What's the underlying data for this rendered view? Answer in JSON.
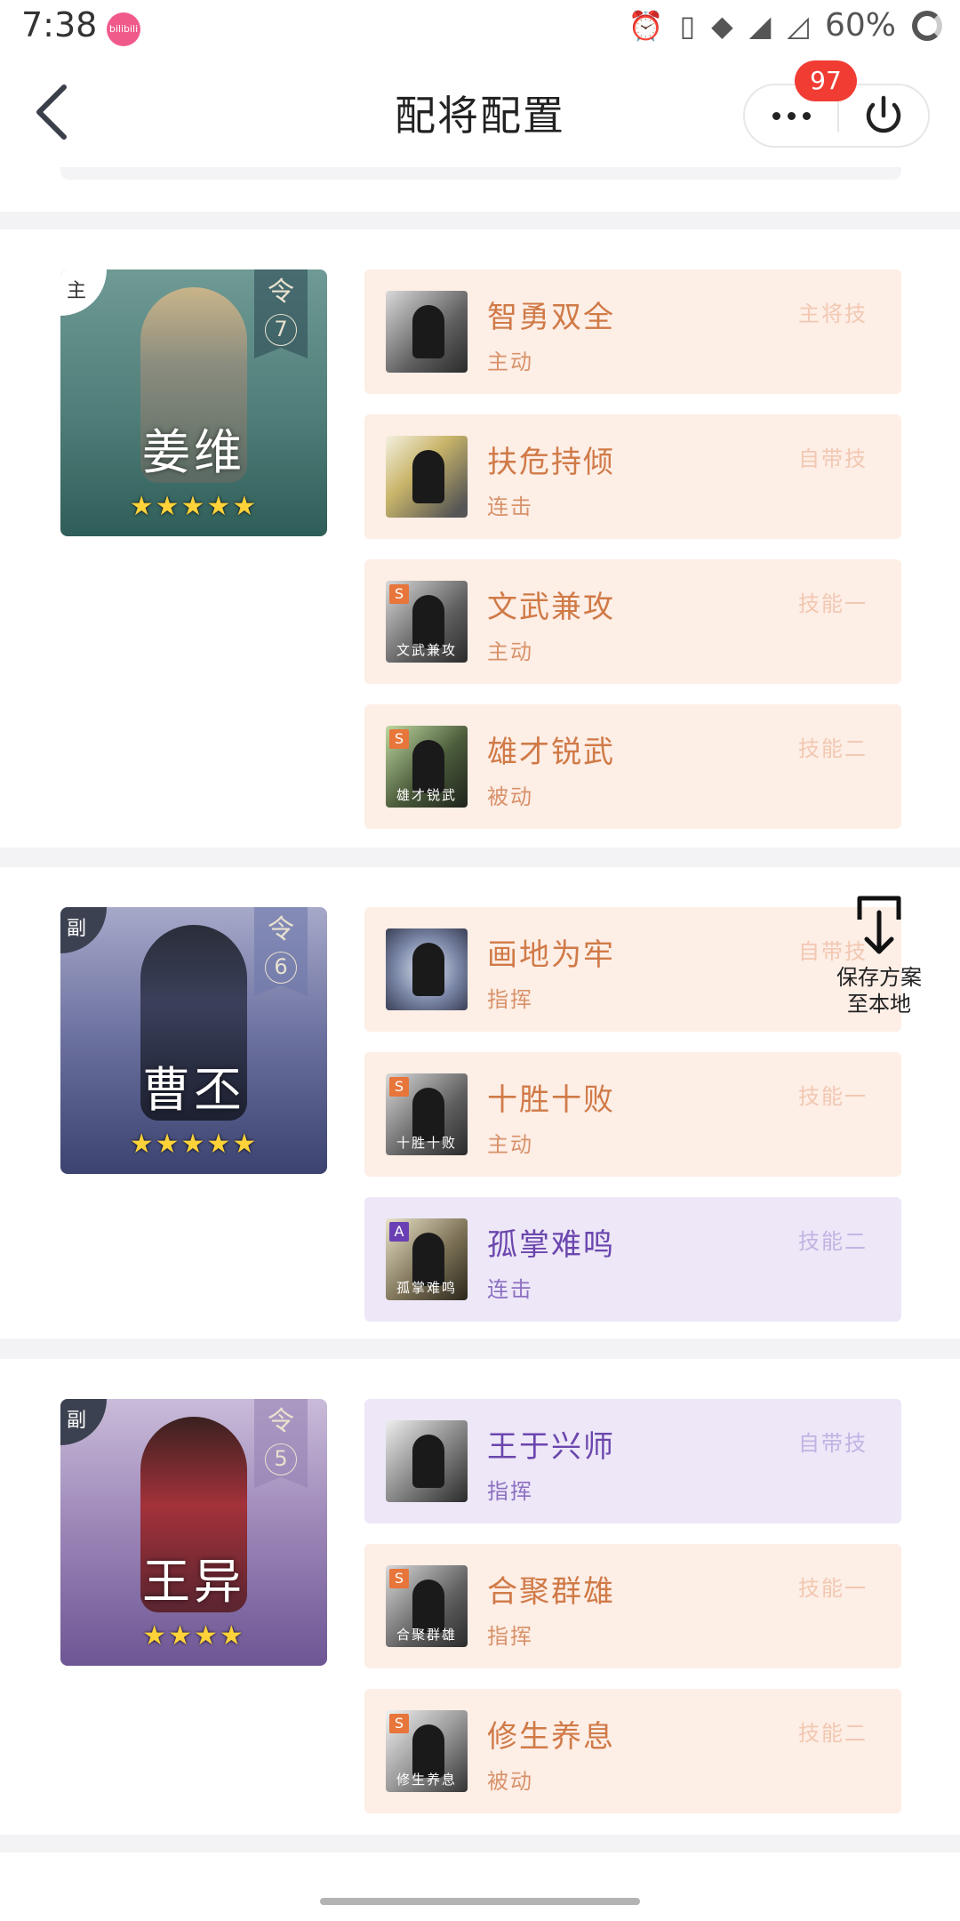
{
  "status_bar": {
    "time": "7:38",
    "app_badge": "bilibili",
    "battery": "60%"
  },
  "nav": {
    "title": "配将配置",
    "badge_count": "97"
  },
  "float_save": {
    "label_line1": "保存方案",
    "label_line2": "至本地"
  },
  "heroes": [
    {
      "tag": "主",
      "name": "姜维",
      "ling": "令",
      "level": "7",
      "stars": "★★★★★",
      "skills": [
        {
          "name": "智勇双全",
          "type": "主动",
          "slot": "主将技",
          "grade": "",
          "caption": "",
          "theme": "orange"
        },
        {
          "name": "扶危持倾",
          "type": "连击",
          "slot": "自带技",
          "grade": "",
          "caption": "",
          "theme": "orange"
        },
        {
          "name": "文武兼攻",
          "type": "主动",
          "slot": "技能一",
          "grade": "S",
          "caption": "文武兼攻",
          "theme": "orange"
        },
        {
          "name": "雄才锐武",
          "type": "被动",
          "slot": "技能二",
          "grade": "S",
          "caption": "雄才锐武",
          "theme": "orange"
        }
      ]
    },
    {
      "tag": "副",
      "name": "曹丕",
      "ling": "令",
      "level": "6",
      "stars": "★★★★★",
      "skills": [
        {
          "name": "画地为牢",
          "type": "指挥",
          "slot": "自带技",
          "grade": "",
          "caption": "",
          "theme": "orange"
        },
        {
          "name": "十胜十败",
          "type": "主动",
          "slot": "技能一",
          "grade": "S",
          "caption": "十胜十败",
          "theme": "orange"
        },
        {
          "name": "孤掌难鸣",
          "type": "连击",
          "slot": "技能二",
          "grade": "A",
          "caption": "孤掌难鸣",
          "theme": "purple"
        }
      ]
    },
    {
      "tag": "副",
      "name": "王异",
      "ling": "令",
      "level": "5",
      "stars": "★★★★",
      "skills": [
        {
          "name": "王于兴师",
          "type": "指挥",
          "slot": "自带技",
          "grade": "",
          "caption": "",
          "theme": "purple"
        },
        {
          "name": "合聚群雄",
          "type": "指挥",
          "slot": "技能一",
          "grade": "S",
          "caption": "合聚群雄",
          "theme": "orange"
        },
        {
          "name": "修生养息",
          "type": "被动",
          "slot": "技能二",
          "grade": "S",
          "caption": "修生养息",
          "theme": "orange"
        }
      ]
    }
  ]
}
